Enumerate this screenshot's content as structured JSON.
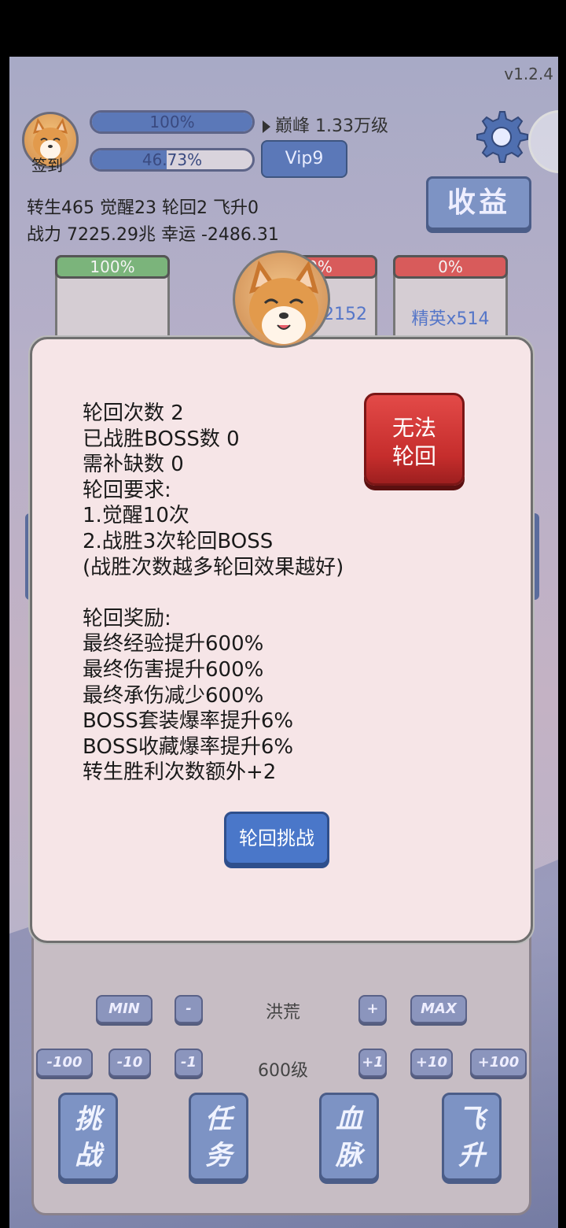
{
  "app": {
    "version": "v1.2.4"
  },
  "header": {
    "sign_label": "签到",
    "hp_bar": {
      "text": "100%",
      "fill": 1.0
    },
    "exp_bar": {
      "text": "46.73%",
      "fill": 0.4673
    },
    "peak_level": "巅峰 1.33万级",
    "vip_label": "Vip9",
    "stats_line1": "转生465 觉醒23 轮回2 飞升0",
    "stats_line2": "战力 7225.29兆  幸运 -2486.31",
    "income_label": "收益"
  },
  "cards": [
    {
      "cap": "100%",
      "cap_color": "#7bb47b",
      "label": ""
    },
    {
      "cap": "0%",
      "cap_color": "#d85b5b",
      "label": "x2152"
    },
    {
      "cap": "0%",
      "cap_color": "#d85b5b",
      "label": "精英x514"
    }
  ],
  "modal": {
    "lines": [
      "轮回次数 2",
      "已战胜BOSS数 0",
      "需补缺数 0",
      "轮回要求:",
      "1.觉醒10次",
      "2.战胜3次轮回BOSS",
      "(战胜次数越多轮回效果越好)",
      "",
      "轮回奖励:",
      "最终经验提升600%",
      "最终伤害提升600%",
      "最终承伤减少600%",
      "BOSS套装爆率提升6%",
      "BOSS收藏爆率提升6%",
      "转生胜利次数额外+2"
    ],
    "cannot_line1": "无法",
    "cannot_line2": "轮回",
    "challenge_label": "轮回挑战"
  },
  "controls": {
    "min": "MIN",
    "minus": "-",
    "region": "洪荒",
    "plus": "+",
    "max": "MAX",
    "m100": "-100",
    "m10": "-10",
    "m1": "-1",
    "level": "600级",
    "p1": "+1",
    "p10": "+10",
    "p100": "+100"
  },
  "bottom_nav": [
    {
      "top": "挑",
      "bottom": "战"
    },
    {
      "top": "任",
      "bottom": "务"
    },
    {
      "top": "血",
      "bottom": "脉"
    },
    {
      "top": "飞",
      "bottom": "升"
    }
  ]
}
